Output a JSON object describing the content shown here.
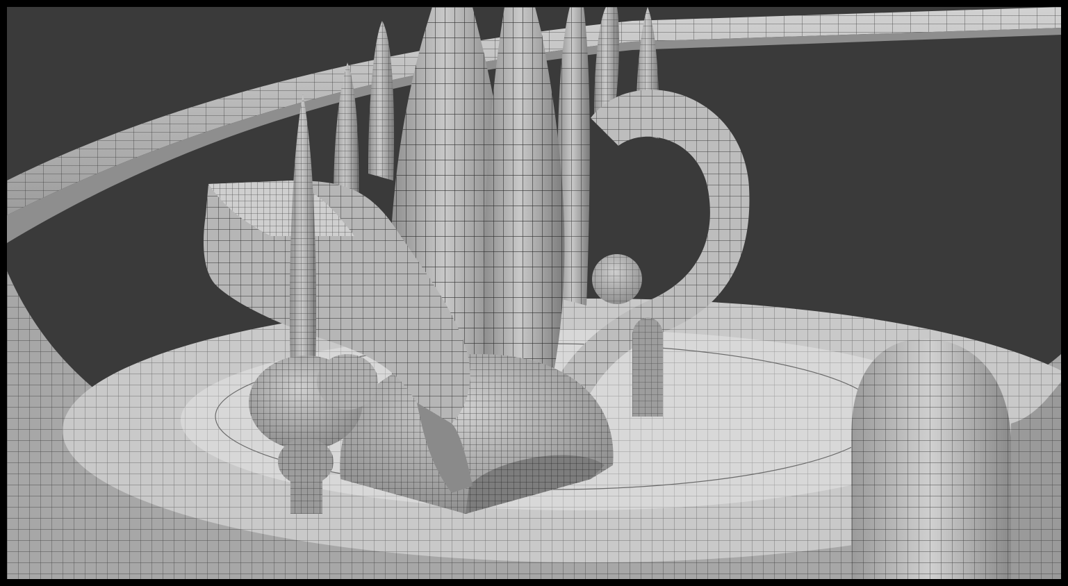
{
  "viewport": {
    "name": "3D viewport",
    "mode": "wireframe-on-shaded"
  },
  "colors": {
    "frame": "#000000",
    "background": "#3a3a3a",
    "surface_light": "#d4d4d4",
    "surface_mid": "#a8a8a8",
    "surface_dark": "#6e6e6e",
    "wire": "#222222"
  },
  "objects": [
    {
      "name": "outer-ring-wall"
    },
    {
      "name": "base-platform"
    },
    {
      "name": "central-spire"
    },
    {
      "name": "tall-spires"
    },
    {
      "name": "twisted-arm"
    },
    {
      "name": "curved-arch"
    },
    {
      "name": "small-tower-left"
    },
    {
      "name": "bulb-ornament"
    },
    {
      "name": "dome-base"
    },
    {
      "name": "rounded-tower-right"
    }
  ]
}
